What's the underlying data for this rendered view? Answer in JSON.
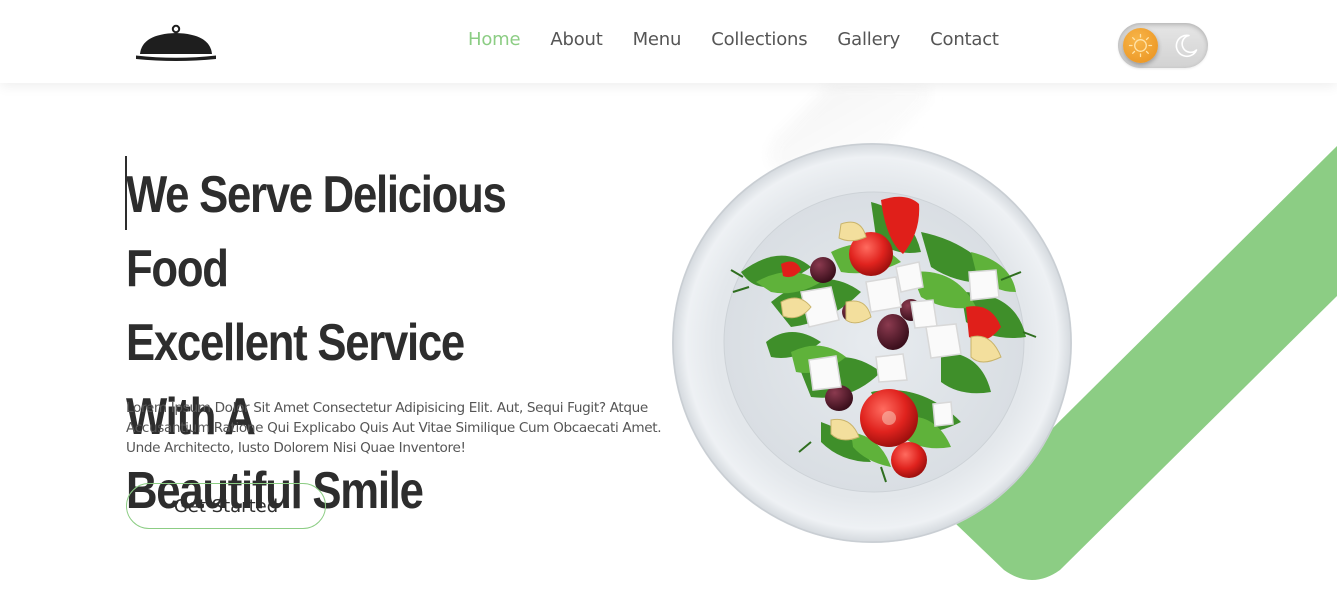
{
  "header": {
    "logo_icon": "serving-cloche-icon",
    "nav": [
      {
        "label": "Home",
        "active": true
      },
      {
        "label": "About",
        "active": false
      },
      {
        "label": "Menu",
        "active": false
      },
      {
        "label": "Collections",
        "active": false
      },
      {
        "label": "Gallery",
        "active": false
      },
      {
        "label": "Contact",
        "active": false
      }
    ],
    "theme_toggle": {
      "state": "light",
      "left_icon": "sun-icon",
      "right_icon": "moon-icon"
    }
  },
  "hero": {
    "title_lines": [
      "We Serve Delicious Food",
      "Excellent Service With A",
      "Beautiful Smile"
    ],
    "description": "Lorem Ipsum Dolor Sit Amet Consectetur Adipisicing Elit. Aut, Sequi Fugit? Atque Accusantium Ratione Qui Explicabo Quis Aut Vitae Similique Cum Obcaecati Amet. Unde Architecto, Iusto Dolorem Nisi Quae Inventore!",
    "cta_label": "Get Started",
    "image": "salad-plate-image"
  },
  "colors": {
    "accent": "#8ccd84",
    "text_dark": "#2d2d2d",
    "text_muted": "#555555",
    "toggle_sun": "#f0a030"
  }
}
